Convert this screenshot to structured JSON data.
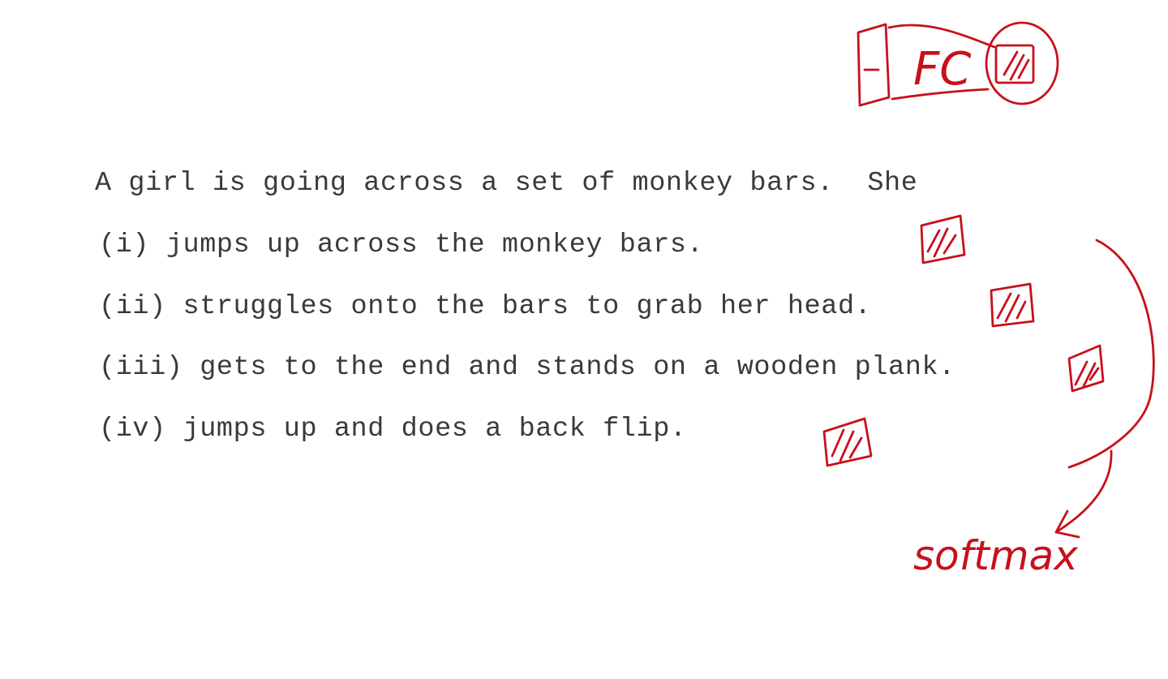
{
  "question": {
    "premise": "A girl is going across a set of monkey bars.  She",
    "options": [
      "(i) jumps up across the monkey bars.",
      "(ii) struggles onto the bars to grab her head.",
      "(iii) gets to the end and stands on a wooden plank.",
      "(iv) jumps up and does a back flip."
    ]
  },
  "annotations": {
    "color": "#c8101c",
    "fc_label": "FC",
    "softmax_label": "softmax"
  }
}
